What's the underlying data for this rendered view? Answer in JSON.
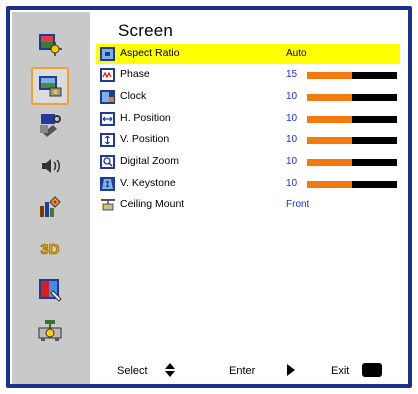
{
  "menu": {
    "title": "Screen",
    "sidebar": [
      {
        "name": "image-settings-icon"
      },
      {
        "name": "screen-settings-icon",
        "active": true
      },
      {
        "name": "setup-icon"
      },
      {
        "name": "audio-icon"
      },
      {
        "name": "options-icon"
      },
      {
        "name": "3d-icon",
        "text": "3D"
      },
      {
        "name": "display-icon"
      },
      {
        "name": "network-icon"
      }
    ],
    "items": [
      {
        "label": "Aspect Ratio",
        "value": "Auto",
        "icon": "aspect-ratio-icon",
        "selected": true
      },
      {
        "label": "Phase",
        "value": "15",
        "icon": "phase-icon",
        "level": 0.5
      },
      {
        "label": "Clock",
        "value": "10",
        "icon": "clock-icon",
        "level": 0.5
      },
      {
        "label": "H. Position",
        "value": "10",
        "icon": "h-position-icon",
        "level": 0.5
      },
      {
        "label": "V. Position",
        "value": "10",
        "icon": "v-position-icon",
        "level": 0.5
      },
      {
        "label": "Digital Zoom",
        "value": "10",
        "icon": "digital-zoom-icon",
        "level": 0.5
      },
      {
        "label": "V. Keystone",
        "value": "10",
        "icon": "v-keystone-icon",
        "level": 0.5
      },
      {
        "label": "Ceiling Mount",
        "value": "Front",
        "icon": "ceiling-mount-icon"
      }
    ]
  },
  "footer": {
    "select_label": "Select",
    "enter_label": "Enter",
    "exit_label": "Exit",
    "menu_key": "Menu"
  },
  "colors": {
    "frame": "#1d2f8f",
    "highlight": "#ffff00",
    "bar_fill": "#f47a10",
    "value_text": "#1a2ee8",
    "active_border": "#f0a030"
  }
}
